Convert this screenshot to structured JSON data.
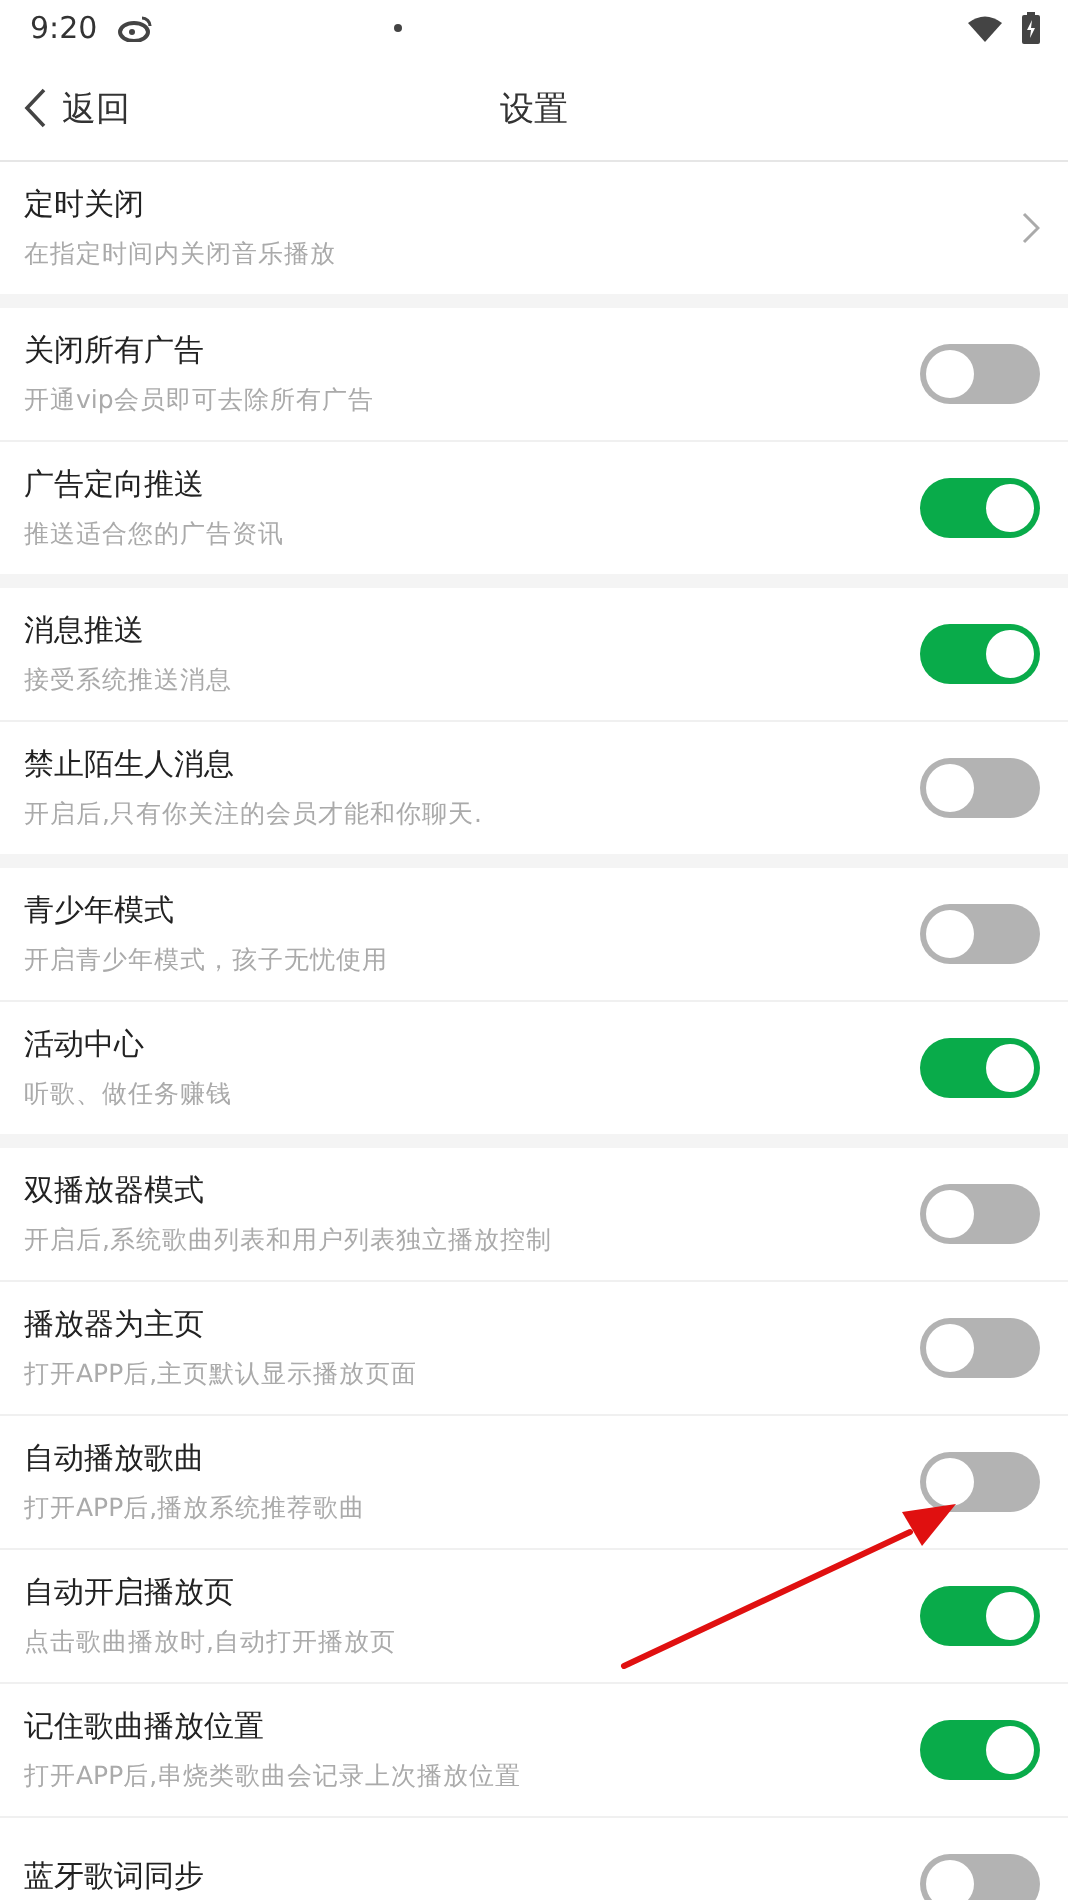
{
  "status_bar": {
    "time": "9:20"
  },
  "header": {
    "back_label": "返回",
    "title": "设置"
  },
  "groups": [
    {
      "items": [
        {
          "kind": "link",
          "title": "定时关闭",
          "subtitle": "在指定时间内关闭音乐播放"
        }
      ]
    },
    {
      "items": [
        {
          "kind": "toggle",
          "title": "关闭所有广告",
          "subtitle": "开通vip会员即可去除所有广告",
          "on": false
        },
        {
          "kind": "toggle",
          "title": "广告定向推送",
          "subtitle": "推送适合您的广告资讯",
          "on": true
        }
      ]
    },
    {
      "items": [
        {
          "kind": "toggle",
          "title": "消息推送",
          "subtitle": "接受系统推送消息",
          "on": true
        },
        {
          "kind": "toggle",
          "title": "禁止陌生人消息",
          "subtitle": "开启后,只有你关注的会员才能和你聊天.",
          "on": false
        }
      ]
    },
    {
      "items": [
        {
          "kind": "toggle",
          "title": "青少年模式",
          "subtitle": "开启青少年模式，孩子无忧使用",
          "on": false
        },
        {
          "kind": "toggle",
          "title": "活动中心",
          "subtitle": "听歌、做任务赚钱",
          "on": true
        }
      ]
    },
    {
      "items": [
        {
          "kind": "toggle",
          "title": "双播放器模式",
          "subtitle": "开启后,系统歌曲列表和用户列表独立播放控制",
          "on": false
        },
        {
          "kind": "toggle",
          "title": "播放器为主页",
          "subtitle": "打开APP后,主页默认显示播放页面",
          "on": false
        },
        {
          "kind": "toggle",
          "title": "自动播放歌曲",
          "subtitle": "打开APP后,播放系统推荐歌曲",
          "on": false
        },
        {
          "kind": "toggle",
          "title": "自动开启播放页",
          "subtitle": "点击歌曲播放时,自动打开播放页",
          "on": true
        },
        {
          "kind": "toggle",
          "title": "记住歌曲播放位置",
          "subtitle": "打开APP后,串烧类歌曲会记录上次播放位置",
          "on": true
        },
        {
          "kind": "toggle",
          "title": "蓝牙歌词同步",
          "on": false
        }
      ]
    }
  ]
}
